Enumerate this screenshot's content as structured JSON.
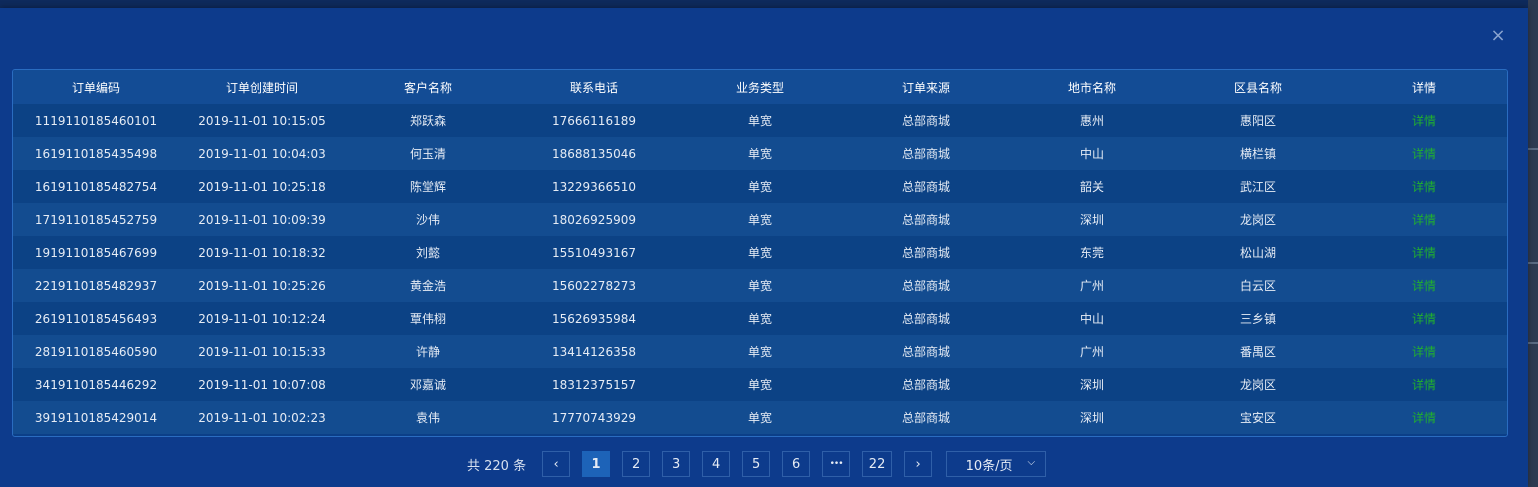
{
  "modal": {
    "close_glyph": "×"
  },
  "table": {
    "headers": [
      "订单编码",
      "订单创建时间",
      "客户名称",
      "联系电话",
      "业务类型",
      "订单来源",
      "地市名称",
      "区县名称",
      "详情"
    ],
    "rows": [
      [
        "1119110185460101",
        "2019-11-01 10:15:05",
        "郑跃森",
        "17666116189",
        "单宽",
        "总部商城",
        "惠州",
        "惠阳区",
        "详情"
      ],
      [
        "1619110185435498",
        "2019-11-01 10:04:03",
        "何玉清",
        "18688135046",
        "单宽",
        "总部商城",
        "中山",
        "横栏镇",
        "详情"
      ],
      [
        "1619110185482754",
        "2019-11-01 10:25:18",
        "陈堂辉",
        "13229366510",
        "单宽",
        "总部商城",
        "韶关",
        "武江区",
        "详情"
      ],
      [
        "1719110185452759",
        "2019-11-01 10:09:39",
        "沙伟",
        "18026925909",
        "单宽",
        "总部商城",
        "深圳",
        "龙岗区",
        "详情"
      ],
      [
        "1919110185467699",
        "2019-11-01 10:18:32",
        "刘懿",
        "15510493167",
        "单宽",
        "总部商城",
        "东莞",
        "松山湖",
        "详情"
      ],
      [
        "2219110185482937",
        "2019-11-01 10:25:26",
        "黄金浩",
        "15602278273",
        "单宽",
        "总部商城",
        "广州",
        "白云区",
        "详情"
      ],
      [
        "2619110185456493",
        "2019-11-01 10:12:24",
        "覃伟栩",
        "15626935984",
        "单宽",
        "总部商城",
        "中山",
        "三乡镇",
        "详情"
      ],
      [
        "2819110185460590",
        "2019-11-01 10:15:33",
        "许静",
        "13414126358",
        "单宽",
        "总部商城",
        "广州",
        "番禺区",
        "详情"
      ],
      [
        "3419110185446292",
        "2019-11-01 10:07:08",
        "邓嘉诚",
        "18312375157",
        "单宽",
        "总部商城",
        "深圳",
        "龙岗区",
        "详情"
      ],
      [
        "3919110185429014",
        "2019-11-01 10:02:23",
        "袁伟",
        "17770743929",
        "单宽",
        "总部商城",
        "深圳",
        "宝安区",
        "详情"
      ]
    ]
  },
  "pagination": {
    "total_label": "共 220 条",
    "prev_glyph": "‹",
    "next_glyph": "›",
    "pages": [
      "1",
      "2",
      "3",
      "4",
      "5",
      "6"
    ],
    "ellipsis": "•••",
    "last_page": "22",
    "current_page": "1",
    "page_size_label": "10条/页",
    "chevron_glyph": "⌵"
  },
  "colors": {
    "modal_bg": "#0d3b8c",
    "header_bg": "#134c95",
    "row_odd": "#0c4285",
    "row_even": "#134c90",
    "detail_link": "#21b02e",
    "active_page": "#1d63b8"
  }
}
